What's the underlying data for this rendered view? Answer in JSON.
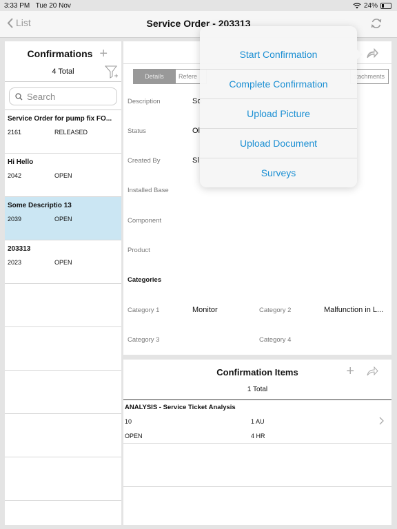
{
  "status_bar": {
    "time": "3:33 PM",
    "date": "Tue 20 Nov",
    "battery": "24%"
  },
  "nav": {
    "back_label": "List",
    "title": "Service Order - 203313"
  },
  "confirmations": {
    "title": "Confirmations",
    "total": "4 Total",
    "search_placeholder": "Search",
    "rows": [
      {
        "title": "Service Order for pump fix FO...",
        "number": "2161",
        "status": "RELEASED"
      },
      {
        "title": "Hi Hello",
        "number": "2042",
        "status": "OPEN"
      },
      {
        "title": "Some Descriptio 13",
        "number": "2039",
        "status": "OPEN"
      },
      {
        "title": "203313",
        "number": "2023",
        "status": "OPEN"
      }
    ]
  },
  "detail": {
    "tabs": {
      "details": "Details",
      "references": "Refere",
      "attachments": "ttachments"
    },
    "labels": {
      "description": "Description",
      "status": "Status",
      "created_by": "Created By",
      "installed_base": "Installed Base",
      "component": "Component",
      "product": "Product",
      "categories": "Categories",
      "category1": "Category 1",
      "category2": "Category 2",
      "category3": "Category 3",
      "category4": "Category 4"
    },
    "values": {
      "description": "So",
      "status": "Ol",
      "created_by": "Sl",
      "category1": "Monitor",
      "category2": "Malfunction in L..."
    }
  },
  "confirmation_items": {
    "title": "Confirmation Items",
    "total": "1 Total",
    "row": {
      "title": "ANALYSIS - Service Ticket Analysis",
      "number": "10",
      "quantity": "1 AU",
      "status": "OPEN",
      "duration": "4 HR"
    }
  },
  "popover": {
    "items": [
      "Start Confirmation",
      "Complete Confirmation",
      "Upload Picture",
      "Upload Document",
      "Surveys"
    ]
  }
}
